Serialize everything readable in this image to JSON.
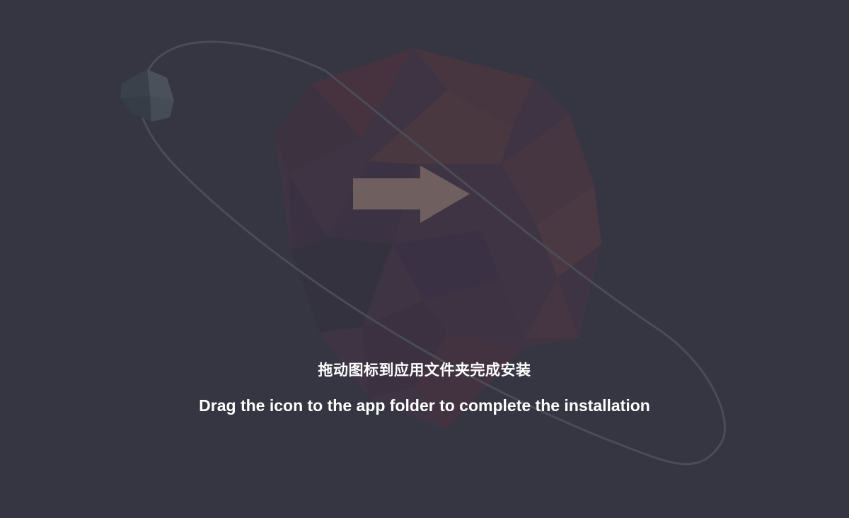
{
  "installer": {
    "instruction_zh": "拖动图标到应用文件夹完成安装",
    "instruction_en": "Drag the icon to the app folder to complete the installation"
  },
  "colors": {
    "background": "#353641",
    "arrow": "#6f5f5f",
    "orbit": "#4b4c55",
    "text": "#ffffff"
  }
}
